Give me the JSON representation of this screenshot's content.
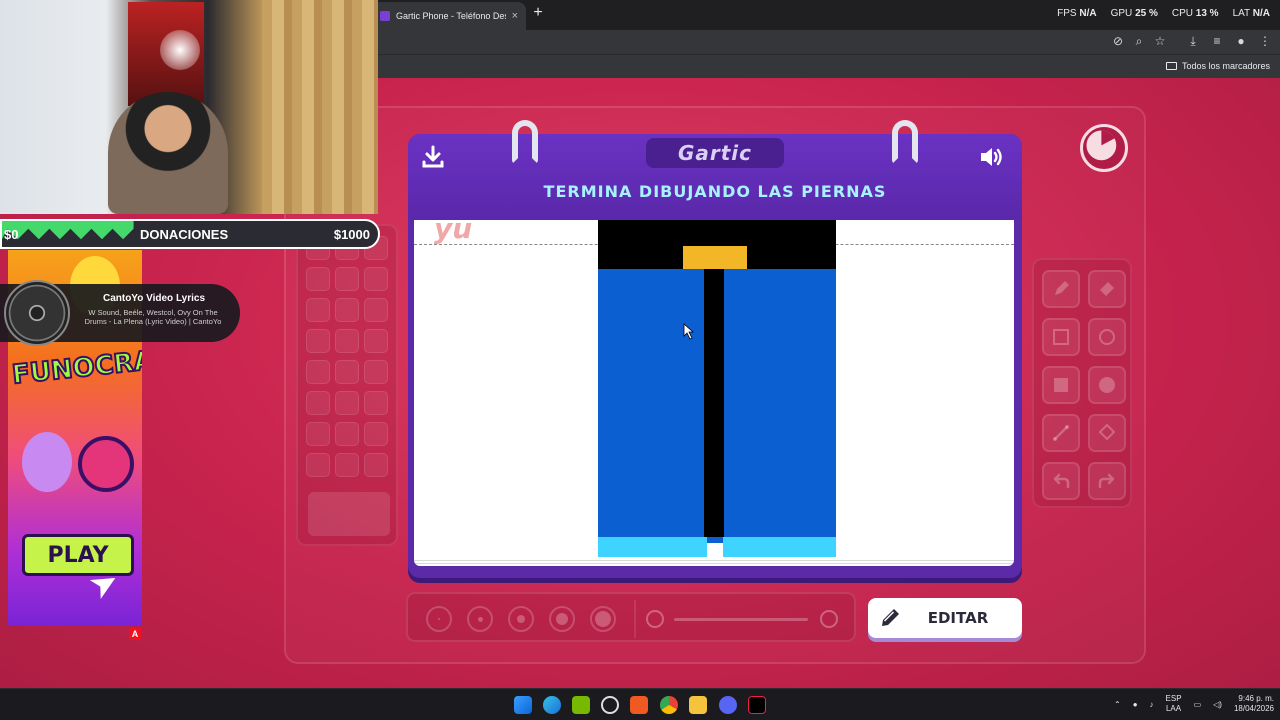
{
  "browser": {
    "tab_title": "Gartic Phone - Teléfono Descon",
    "tab_close": "×",
    "new_tab": "+",
    "perf": [
      {
        "label": "FPS",
        "value": "N/A"
      },
      {
        "label": "GPU",
        "value": "25 %"
      },
      {
        "label": "CPU",
        "value": "13 %"
      },
      {
        "label": "LAT",
        "value": "N/A"
      }
    ],
    "bookmarks_label": "Todos los marcadores"
  },
  "game": {
    "logo": "Gartic",
    "prompt": "TERMINA DIBUJANDO LAS PIERNAS",
    "prev_ink": "yu",
    "edit_label": "EDITAR",
    "accent": "#5a28aa",
    "prompt_color": "#a6f2ff",
    "icons": [
      "download-icon",
      "volume-icon",
      "timer-icon",
      "pencil-icon",
      "eraser-icon",
      "square-icon",
      "circle-icon",
      "filled-square-icon",
      "filled-circle-icon",
      "line-icon",
      "fill-icon",
      "undo-icon",
      "redo-icon"
    ]
  },
  "overlay": {
    "donations": {
      "min": "$0",
      "title": "DONACIONES",
      "max": "$1000",
      "progress": 0.35
    },
    "now_playing": {
      "title": "CantoYo Video Lyrics",
      "subtitle": "W Sound, Beéle, Westcol, Ovy On The Drums - La Plena (Lyric Video) | CantoYo"
    },
    "ad": {
      "logo": "FUNOCRACY",
      "play": "PLAY",
      "badge": "A"
    }
  },
  "taskbar": {
    "lang_top": "ESP",
    "lang_bottom": "LAA",
    "time": "9:46 p. m.",
    "date": "18/04/2026"
  }
}
